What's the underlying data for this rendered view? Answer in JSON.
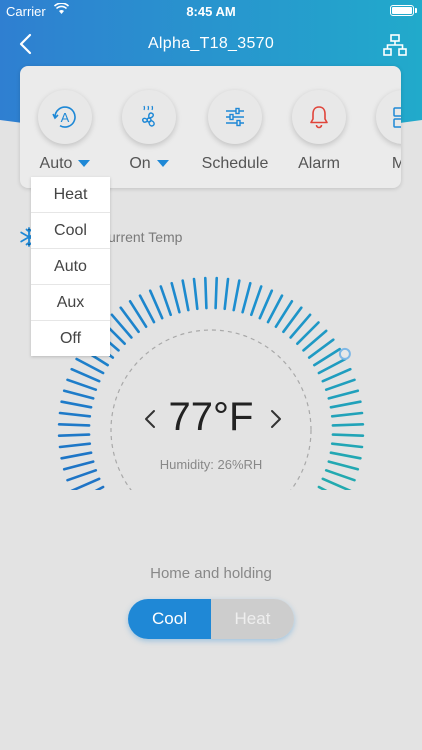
{
  "status_bar": {
    "carrier": "Carrier",
    "time": "8:45 AM"
  },
  "navbar": {
    "title": "Alpha_T18_3570",
    "back_icon": "chevron-left-icon",
    "network_icon": "network-tree-icon"
  },
  "colors": {
    "header_start": "#2f7fd1",
    "header_end": "#21aacb",
    "accent": "#1f88d6",
    "teal": "#24b0a8"
  },
  "mode_bar": {
    "items": [
      {
        "label": "Auto",
        "icon": "auto-mode-icon",
        "has_dropdown": true
      },
      {
        "label": "On",
        "icon": "fan-icon",
        "has_dropdown": true
      },
      {
        "label": "Schedule",
        "icon": "sliders-icon",
        "has_dropdown": false
      },
      {
        "label": "Alarm",
        "icon": "bell-icon",
        "has_dropdown": false
      },
      {
        "label": "Me",
        "icon": "menu-icon",
        "has_dropdown": false
      }
    ]
  },
  "mode_dropdown": {
    "options": [
      "Heat",
      "Cool",
      "Auto",
      "Aux",
      "Off"
    ]
  },
  "current_temp_label": "urrent Temp",
  "dial": {
    "setpoint_display": "77°F",
    "humidity": "Humidity: 26%RH",
    "level_fraction": 0.8
  },
  "hold_status": "Home and holding",
  "toggle": {
    "cool": "Cool",
    "heat": "Heat",
    "active": "cool"
  }
}
